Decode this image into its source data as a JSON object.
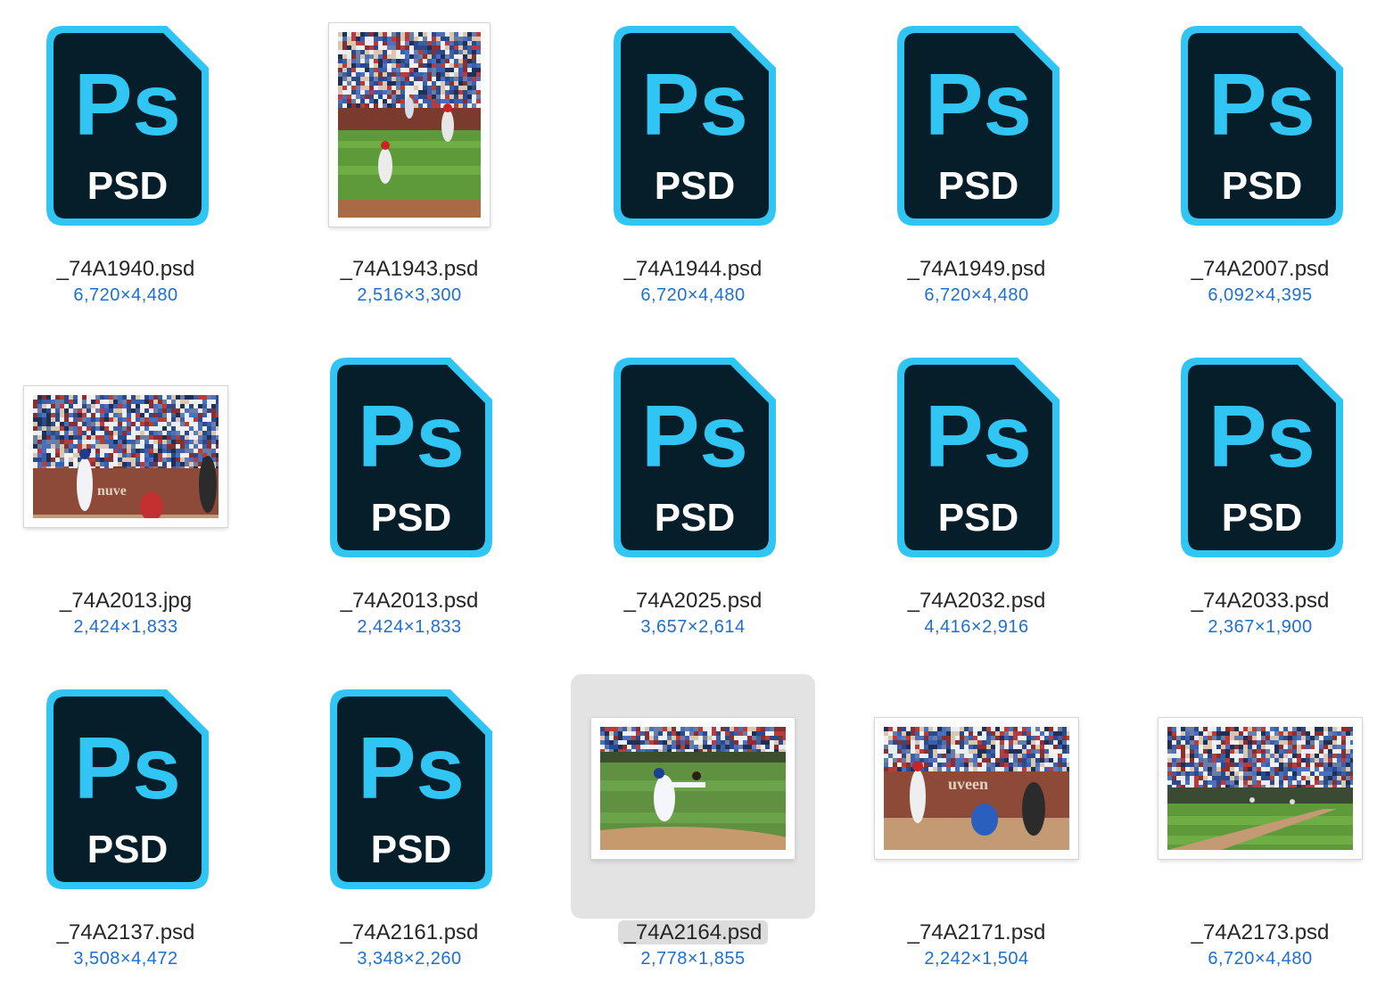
{
  "files": [
    {
      "name": "_74A1940.psd",
      "dims": "6,720×4,480",
      "icon": "ps-file-icon"
    },
    {
      "name": "_74A1943.psd",
      "dims": "2,516×3,300",
      "icon": "photo-thumbnail",
      "scene": "fielders",
      "orientation": "portrait"
    },
    {
      "name": "_74A1944.psd",
      "dims": "6,720×4,480",
      "icon": "ps-file-icon"
    },
    {
      "name": "_74A1949.psd",
      "dims": "6,720×4,480",
      "icon": "ps-file-icon"
    },
    {
      "name": "_74A2007.psd",
      "dims": "6,092×4,395",
      "icon": "ps-file-icon"
    },
    {
      "name": "_74A2013.jpg",
      "dims": "2,424×1,833",
      "icon": "photo-thumbnail",
      "scene": "batter-wall",
      "orientation": "landscape"
    },
    {
      "name": "_74A2013.psd",
      "dims": "2,424×1,833",
      "icon": "ps-file-icon"
    },
    {
      "name": "_74A2025.psd",
      "dims": "3,657×2,614",
      "icon": "ps-file-icon"
    },
    {
      "name": "_74A2032.psd",
      "dims": "4,416×2,916",
      "icon": "ps-file-icon"
    },
    {
      "name": "_74A2033.psd",
      "dims": "2,367×1,900",
      "icon": "ps-file-icon"
    },
    {
      "name": "_74A2137.psd",
      "dims": "3,508×4,472",
      "icon": "ps-file-icon"
    },
    {
      "name": "_74A2161.psd",
      "dims": "3,348×2,260",
      "icon": "ps-file-icon"
    },
    {
      "name": "_74A2164.psd",
      "dims": "2,778×1,855",
      "icon": "photo-thumbnail",
      "scene": "pitcher",
      "orientation": "landscape",
      "selected": true
    },
    {
      "name": "_74A2171.psd",
      "dims": "2,242×1,504",
      "icon": "photo-thumbnail",
      "scene": "batter-catcher",
      "orientation": "landscape"
    },
    {
      "name": "_74A2173.psd",
      "dims": "6,720×4,480",
      "icon": "photo-thumbnail",
      "scene": "wide-field",
      "orientation": "landscape"
    }
  ],
  "ps_icon": {
    "top_text": "Ps",
    "bottom_text": "PSD"
  },
  "colors": {
    "ps_body": "#061e29",
    "ps_accent": "#31c5f4",
    "filename_text": "#262626",
    "dims_text": "#1d6fd1",
    "selection_bg": "#e3e3e3"
  }
}
